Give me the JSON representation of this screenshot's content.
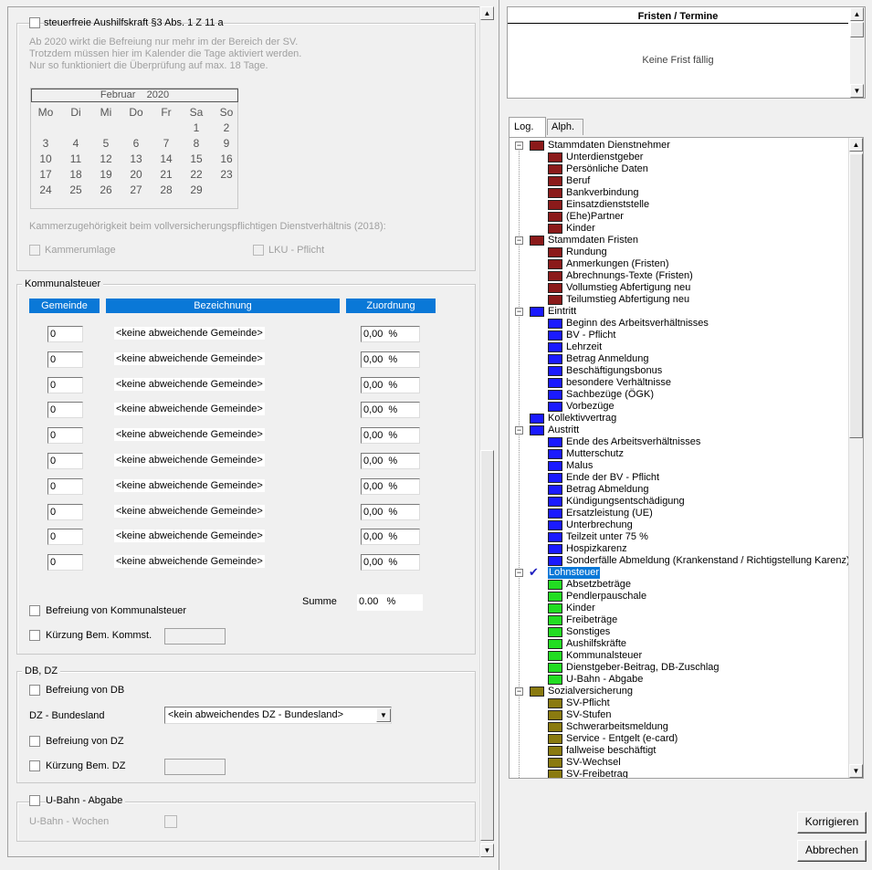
{
  "aushilfskraft": {
    "checkbox_label": "steuerfreie Aushilfskraft §3 Abs. 1 Z 11 a",
    "info_line1": "Ab 2020 wirkt die Befreiung nur mehr im der Bereich der SV.",
    "info_line2": "Trotzdem müssen hier im Kalender die Tage aktiviert werden.",
    "info_line3": "Nur so funktioniert die Überprüfung auf max. 18 Tage."
  },
  "calendar": {
    "month": "Februar",
    "year": "2020",
    "weekdays": [
      "Mo",
      "Di",
      "Mi",
      "Do",
      "Fr",
      "Sa",
      "So"
    ],
    "weeks": [
      [
        "",
        "",
        "",
        "",
        "",
        "1",
        "2"
      ],
      [
        "3",
        "4",
        "5",
        "6",
        "7",
        "8",
        "9"
      ],
      [
        "10",
        "11",
        "12",
        "13",
        "14",
        "15",
        "16"
      ],
      [
        "17",
        "18",
        "19",
        "20",
        "21",
        "22",
        "23"
      ],
      [
        "24",
        "25",
        "26",
        "27",
        "28",
        "29",
        ""
      ]
    ]
  },
  "kammer": {
    "label": "Kammerzugehörigkeit beim vollversicherungspflichtigen Dienstverhältnis (2018):",
    "kammerumlage": "Kammerumlage",
    "lku": "LKU - Pflicht"
  },
  "kommunal": {
    "group_title": "Kommunalsteuer",
    "col_gemeinde": "Gemeinde",
    "col_bezeichnung": "Bezeichnung",
    "col_zuordnung": "Zuordnung",
    "rows": [
      {
        "gemeinde": "0",
        "bezeichnung": "<keine abweichende Gemeinde>",
        "zuordnung": "0,00",
        "unit": "%"
      },
      {
        "gemeinde": "0",
        "bezeichnung": "<keine abweichende Gemeinde>",
        "zuordnung": "0,00",
        "unit": "%"
      },
      {
        "gemeinde": "0",
        "bezeichnung": "<keine abweichende Gemeinde>",
        "zuordnung": "0,00",
        "unit": "%"
      },
      {
        "gemeinde": "0",
        "bezeichnung": "<keine abweichende Gemeinde>",
        "zuordnung": "0,00",
        "unit": "%"
      },
      {
        "gemeinde": "0",
        "bezeichnung": "<keine abweichende Gemeinde>",
        "zuordnung": "0,00",
        "unit": "%"
      },
      {
        "gemeinde": "0",
        "bezeichnung": "<keine abweichende Gemeinde>",
        "zuordnung": "0,00",
        "unit": "%"
      },
      {
        "gemeinde": "0",
        "bezeichnung": "<keine abweichende Gemeinde>",
        "zuordnung": "0,00",
        "unit": "%"
      },
      {
        "gemeinde": "0",
        "bezeichnung": "<keine abweichende Gemeinde>",
        "zuordnung": "0,00",
        "unit": "%"
      },
      {
        "gemeinde": "0",
        "bezeichnung": "<keine abweichende Gemeinde>",
        "zuordnung": "0,00",
        "unit": "%"
      },
      {
        "gemeinde": "0",
        "bezeichnung": "<keine abweichende Gemeinde>",
        "zuordnung": "0,00",
        "unit": "%"
      }
    ],
    "summe_label": "Summe",
    "summe_value": "0.00",
    "summe_unit": "%",
    "befreiung": "Befreiung von Kommunalsteuer",
    "kuerzung": "Kürzung Bem. Kommst."
  },
  "dbdz": {
    "group_title": "DB, DZ",
    "befreiung_db": "Befreiung von DB",
    "dz_bundesland_label": "DZ - Bundesland",
    "dz_bundesland_value": "<kein abweichendes DZ - Bundesland>",
    "befreiung_dz": "Befreiung von DZ",
    "kuerzung_dz": "Kürzung Bem. DZ"
  },
  "ubahn": {
    "group_title": "U-Bahn - Abgabe",
    "wochen": "U-Bahn - Wochen"
  },
  "fristen": {
    "title": "Fristen / Termine",
    "empty": "Keine Frist fällig"
  },
  "tabs": [
    "Log.",
    "Alph."
  ],
  "tree": [
    {
      "label": "Stammdaten Dienstnehmer",
      "level": 0,
      "color": "#8b1a1a",
      "open": true
    },
    {
      "label": "Unterdienstgeber",
      "level": 1,
      "color": "#8b1a1a"
    },
    {
      "label": "Persönliche Daten",
      "level": 1,
      "color": "#8b1a1a"
    },
    {
      "label": "Beruf",
      "level": 1,
      "color": "#8b1a1a"
    },
    {
      "label": "Bankverbindung",
      "level": 1,
      "color": "#8b1a1a"
    },
    {
      "label": "Einsatzdienststelle",
      "level": 1,
      "color": "#8b1a1a"
    },
    {
      "label": "(Ehe)Partner",
      "level": 1,
      "color": "#8b1a1a"
    },
    {
      "label": "Kinder",
      "level": 1,
      "color": "#8b1a1a"
    },
    {
      "label": "Stammdaten Fristen",
      "level": 0,
      "color": "#8b1a1a",
      "open": true
    },
    {
      "label": "Rundung",
      "level": 1,
      "color": "#8b1a1a"
    },
    {
      "label": "Anmerkungen (Fristen)",
      "level": 1,
      "color": "#8b1a1a"
    },
    {
      "label": "Abrechnungs-Texte (Fristen)",
      "level": 1,
      "color": "#8b1a1a"
    },
    {
      "label": "Vollumstieg Abfertigung neu",
      "level": 1,
      "color": "#8b1a1a"
    },
    {
      "label": "Teilumstieg Abfertigung neu",
      "level": 1,
      "color": "#8b1a1a"
    },
    {
      "label": "Eintritt",
      "level": 0,
      "color": "#1a1aff",
      "open": true
    },
    {
      "label": "Beginn des Arbeitsverhältnisses",
      "level": 1,
      "color": "#1a1aff"
    },
    {
      "label": "BV - Pflicht",
      "level": 1,
      "color": "#1a1aff"
    },
    {
      "label": "Lehrzeit",
      "level": 1,
      "color": "#1a1aff"
    },
    {
      "label": "Betrag Anmeldung",
      "level": 1,
      "color": "#1a1aff"
    },
    {
      "label": "Beschäftigungsbonus",
      "level": 1,
      "color": "#1a1aff"
    },
    {
      "label": "besondere Verhältnisse",
      "level": 1,
      "color": "#1a1aff"
    },
    {
      "label": "Sachbezüge (ÖGK)",
      "level": 1,
      "color": "#1a1aff"
    },
    {
      "label": "Vorbezüge",
      "level": 1,
      "color": "#1a1aff"
    },
    {
      "label": "Kollektivvertrag",
      "level": 0,
      "color": "#1a1aff",
      "nolink": true
    },
    {
      "label": "Austritt",
      "level": 0,
      "color": "#1a1aff",
      "open": true
    },
    {
      "label": "Ende des Arbeitsverhältnisses",
      "level": 1,
      "color": "#1a1aff"
    },
    {
      "label": "Mutterschutz",
      "level": 1,
      "color": "#1a1aff"
    },
    {
      "label": "Malus",
      "level": 1,
      "color": "#1a1aff"
    },
    {
      "label": "Ende der BV - Pflicht",
      "level": 1,
      "color": "#1a1aff"
    },
    {
      "label": "Betrag Abmeldung",
      "level": 1,
      "color": "#1a1aff"
    },
    {
      "label": "Kündigungsentschädigung",
      "level": 1,
      "color": "#1a1aff"
    },
    {
      "label": "Ersatzleistung (UE)",
      "level": 1,
      "color": "#1a1aff"
    },
    {
      "label": "Unterbrechung",
      "level": 1,
      "color": "#1a1aff"
    },
    {
      "label": "Teilzeit unter 75 %",
      "level": 1,
      "color": "#1a1aff"
    },
    {
      "label": "Hospizkarenz",
      "level": 1,
      "color": "#1a1aff"
    },
    {
      "label": "Sonderfälle Abmeldung (Krankenstand / Richtigstellung Karenz)",
      "level": 1,
      "color": "#1a1aff"
    },
    {
      "label": "Lohnsteuer",
      "level": 0,
      "color": "#22cc22",
      "open": true,
      "selected": true,
      "check": true
    },
    {
      "label": "Absetzbeträge",
      "level": 1,
      "color": "#22dd22"
    },
    {
      "label": "Pendlerpauschale",
      "level": 1,
      "color": "#22dd22"
    },
    {
      "label": "Kinder",
      "level": 1,
      "color": "#22dd22"
    },
    {
      "label": "Freibeträge",
      "level": 1,
      "color": "#22dd22"
    },
    {
      "label": "Sonstiges",
      "level": 1,
      "color": "#22dd22"
    },
    {
      "label": "Aushilfskräfte",
      "level": 1,
      "color": "#22dd22"
    },
    {
      "label": "Kommunalsteuer",
      "level": 1,
      "color": "#22dd22"
    },
    {
      "label": "Dienstgeber-Beitrag, DB-Zuschlag",
      "level": 1,
      "color": "#22dd22"
    },
    {
      "label": "U-Bahn - Abgabe",
      "level": 1,
      "color": "#22dd22"
    },
    {
      "label": "Sozialversicherung",
      "level": 0,
      "color": "#8a7a10",
      "open": true
    },
    {
      "label": "SV-Pflicht",
      "level": 1,
      "color": "#8a7a10"
    },
    {
      "label": "SV-Stufen",
      "level": 1,
      "color": "#8a7a10"
    },
    {
      "label": "Schwerarbeitsmeldung",
      "level": 1,
      "color": "#8a7a10"
    },
    {
      "label": "Service - Entgelt (e-card)",
      "level": 1,
      "color": "#8a7a10"
    },
    {
      "label": "fallweise beschäftigt",
      "level": 1,
      "color": "#8a7a10"
    },
    {
      "label": "SV-Wechsel",
      "level": 1,
      "color": "#8a7a10"
    },
    {
      "label": "SV-Freibetrag",
      "level": 1,
      "color": "#8a7a10"
    }
  ],
  "buttons": {
    "korrigieren": "Korrigieren",
    "abbrechen": "Abbrechen"
  }
}
